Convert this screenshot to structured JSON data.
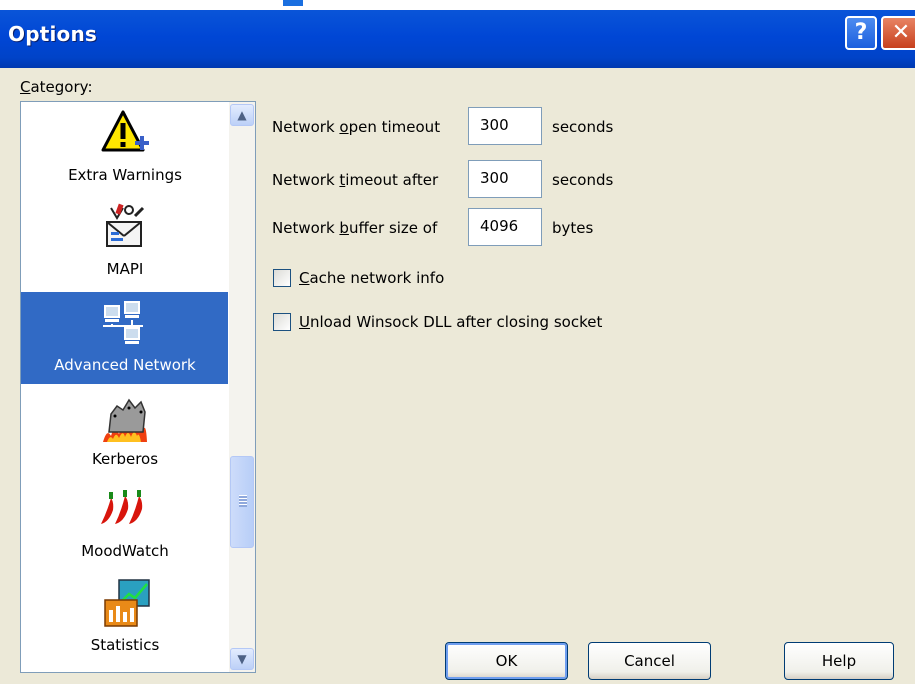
{
  "window": {
    "title": "Options"
  },
  "titlebar": {
    "help_glyph": "?",
    "close_glyph": "✕"
  },
  "category": {
    "label_prefix": "C",
    "label_rest": "ategory:",
    "items": [
      {
        "label": "Extra Warnings",
        "icon": "warning-icon",
        "selected": false
      },
      {
        "label": "MAPI",
        "icon": "mapi-icon",
        "selected": false
      },
      {
        "label": "Advanced Network",
        "icon": "network-icon",
        "selected": true
      },
      {
        "label": "Kerberos",
        "icon": "kerberos-icon",
        "selected": false
      },
      {
        "label": "MoodWatch",
        "icon": "moodwatch-icon",
        "selected": false
      },
      {
        "label": "Statistics",
        "icon": "statistics-icon",
        "selected": false
      }
    ]
  },
  "settings": {
    "open_timeout": {
      "label_a": "Network ",
      "label_key": "o",
      "label_b": "pen timeout",
      "value": "300",
      "unit": "seconds"
    },
    "timeout_after": {
      "label_a": "Network ",
      "label_key": "t",
      "label_b": "imeout after",
      "value": "300",
      "unit": "seconds"
    },
    "buffer_size": {
      "label_a": "Network ",
      "label_key": "b",
      "label_b": "uffer size of",
      "value": "4096",
      "unit": "bytes"
    },
    "cache_network_info": {
      "label_key": "C",
      "label_rest": "ache network info",
      "checked": false
    },
    "unload_winsock": {
      "label_key": "U",
      "label_rest": "nload Winsock DLL after closing socket",
      "checked": false
    }
  },
  "buttons": {
    "ok": "OK",
    "cancel": "Cancel",
    "help": "Help"
  },
  "colors": {
    "titlebar": "#0046d5",
    "selection": "#316ac5",
    "dialog_bg": "#ece9d8"
  }
}
